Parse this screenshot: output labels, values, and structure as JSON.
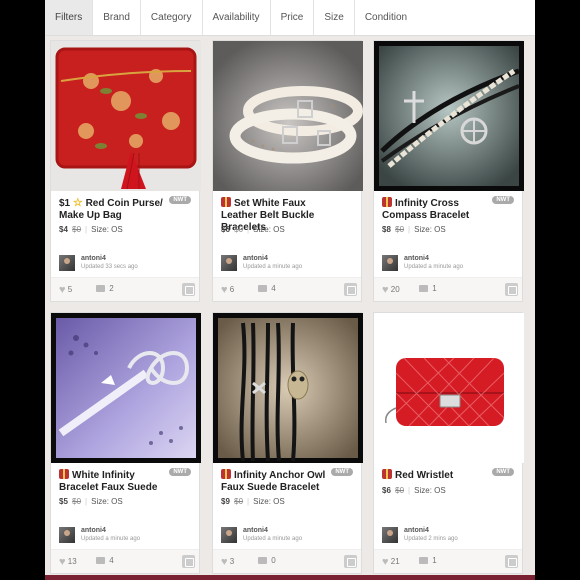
{
  "filters": [
    "Filters",
    "Brand",
    "Category",
    "Availability",
    "Price",
    "Size",
    "Condition"
  ],
  "listings": [
    {
      "title_line1": "$1",
      "title_rest": "Red Coin Purse/ Make Up Bag",
      "badge": "NWT",
      "price": "$4",
      "original": "$0",
      "size": "Size: OS",
      "seller": "antoni4",
      "updated": "Updated 33 secs ago",
      "likes": "5",
      "comments": "2",
      "icon": "star-icon"
    },
    {
      "title_rest": "Set White Faux Leather Belt Buckle Bracelets",
      "price": "$6",
      "original": "$0",
      "size": "Size: OS",
      "seller": "antoni4",
      "updated": "Updated a minute ago",
      "likes": "6",
      "comments": "4",
      "icon": "gift-icon"
    },
    {
      "title_rest": "Infinity Cross Compass Bracelet",
      "badge": "NWT",
      "price": "$8",
      "original": "$0",
      "size": "Size: OS",
      "seller": "antoni4",
      "updated": "Updated a minute ago",
      "likes": "20",
      "comments": "1",
      "icon": "gift-icon"
    },
    {
      "title_rest": "White Infinity Bracelet Faux Suede",
      "badge": "NWT",
      "price": "$5",
      "original": "$0",
      "size": "Size: OS",
      "seller": "antoni4",
      "updated": "Updated a minute ago",
      "likes": "13",
      "comments": "4",
      "icon": "gift-icon"
    },
    {
      "title_rest": "Infinity Anchor Owl Faux Suede Bracelet",
      "badge": "NWT",
      "price": "$9",
      "original": "$0",
      "size": "Size: OS",
      "seller": "antoni4",
      "updated": "Updated a minute ago",
      "likes": "3",
      "comments": "0",
      "icon": "gift-icon"
    },
    {
      "title_rest": "Red Wristlet",
      "badge": "NWT",
      "price": "$6",
      "original": "$0",
      "size": "Size: OS",
      "seller": "antoni4",
      "updated": "Updated 2 mins ago",
      "likes": "21",
      "comments": "1",
      "icon": "gift-icon"
    }
  ],
  "colors": {
    "accent": "#7a2231",
    "nwt_badge": "#aaaaaa"
  }
}
